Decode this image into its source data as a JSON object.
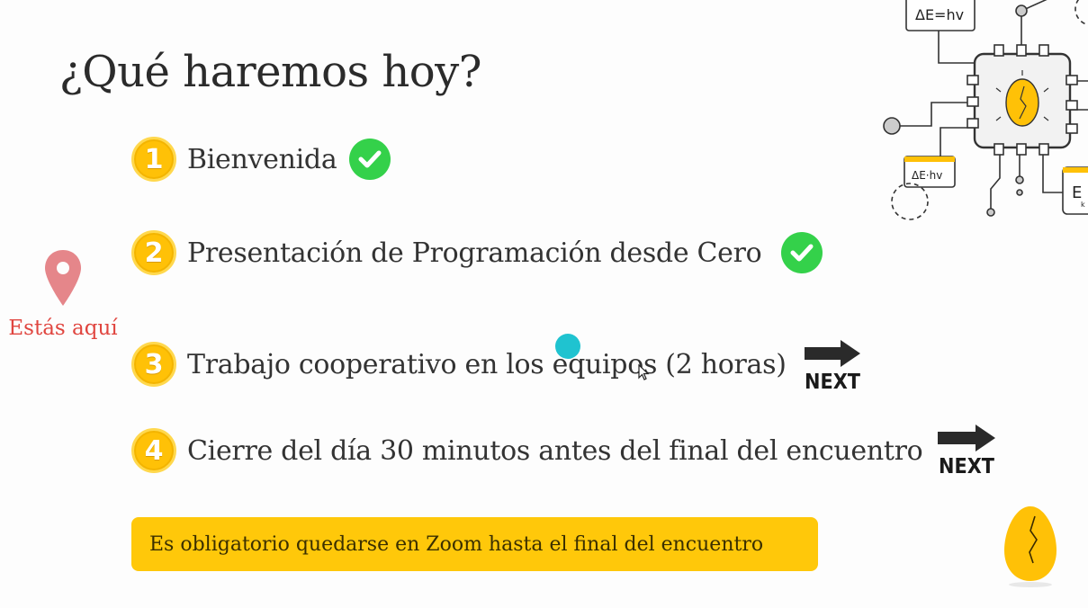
{
  "slide": {
    "title": "¿Qué haremos hoy?",
    "you_are_here": "Estás aquí",
    "agenda": [
      {
        "number": "1",
        "label": "Bienvenida",
        "status": "done"
      },
      {
        "number": "2",
        "label": "Presentación de Programación desde Cero",
        "status": "done"
      },
      {
        "number": "3",
        "label": "Trabajo cooperativo en los equipos (2 horas)",
        "status": "next"
      },
      {
        "number": "4",
        "label": "Cierre del día 30 minutos antes del final del encuentro",
        "status": "next"
      }
    ],
    "next_label": "NEXT",
    "notice": "Es obligatorio quedarse en Zoom hasta el final del encuentro"
  },
  "illustration": {
    "formula_top": "ΔE=hv",
    "formula_left": "ΔE·hv",
    "formula_right": "E",
    "formula_right_sub": "k"
  },
  "colors": {
    "accent_yellow": "#ffc107",
    "check_green": "#34d14a",
    "marker_red": "#e0453f",
    "cursor_cyan": "#1fc3d0"
  },
  "icons": [
    "check-circle-icon",
    "next-arrow-icon",
    "map-pin-icon",
    "egg-icon",
    "circuit-illustration",
    "mouse-pointer-icon"
  ]
}
